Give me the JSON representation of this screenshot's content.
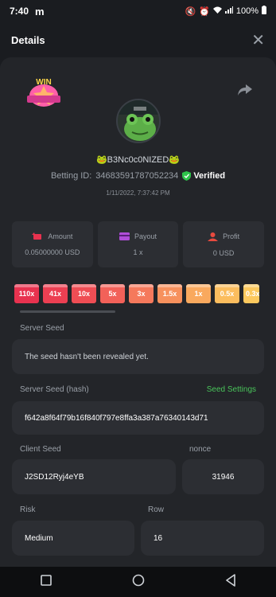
{
  "status_bar": {
    "time": "7:40",
    "app_glyph": "m",
    "battery": "100%"
  },
  "header": {
    "title": "Details"
  },
  "bet": {
    "username": "🐸B3Nc0c0NIZED🐸",
    "betting_id_label": "Betting ID:",
    "betting_id": "34683591787052234",
    "verified_label": "Verified",
    "date": "1/11/2022, 7:37:42 PM"
  },
  "badge": {
    "text": "WIN"
  },
  "stats": [
    {
      "label": "Amount",
      "value": "0.05000000 USD",
      "icon": "money-wings-icon"
    },
    {
      "label": "Payout",
      "value": "1 x",
      "icon": "card-icon"
    },
    {
      "label": "Profit",
      "value": "0 USD",
      "icon": "profit-person-icon"
    }
  ],
  "multipliers": [
    {
      "label": "110x",
      "color": "#e8324f"
    },
    {
      "label": "41x",
      "color": "#ec3f52"
    },
    {
      "label": "10x",
      "color": "#ef4d54"
    },
    {
      "label": "5x",
      "color": "#f26159"
    },
    {
      "label": "3x",
      "color": "#f5795c"
    },
    {
      "label": "1.5x",
      "color": "#f7915d"
    },
    {
      "label": "1x",
      "color": "#f9a95e"
    },
    {
      "label": "0.5x",
      "color": "#fbbd5e"
    },
    {
      "label": "0.3x",
      "color": "#fcc95e"
    }
  ],
  "server_seed": {
    "label": "Server Seed",
    "value": "The seed hasn't been revealed yet."
  },
  "server_seed_hash": {
    "label": "Server Seed (hash)",
    "settings_label": "Seed Settings",
    "value": "f642a8f64f79b16f840f797e8ffa3a387a76340143d71"
  },
  "client_seed": {
    "label": "Client Seed",
    "value": "J2SD12Ryj4eYB"
  },
  "nonce": {
    "label": "nonce",
    "value": "31946"
  },
  "risk": {
    "label": "Risk",
    "value": "Medium"
  },
  "row": {
    "label": "Row",
    "value": "16"
  },
  "colors": {
    "accent_green": "#49c45a",
    "panel": "#2c2e33",
    "sheet": "#232529"
  }
}
